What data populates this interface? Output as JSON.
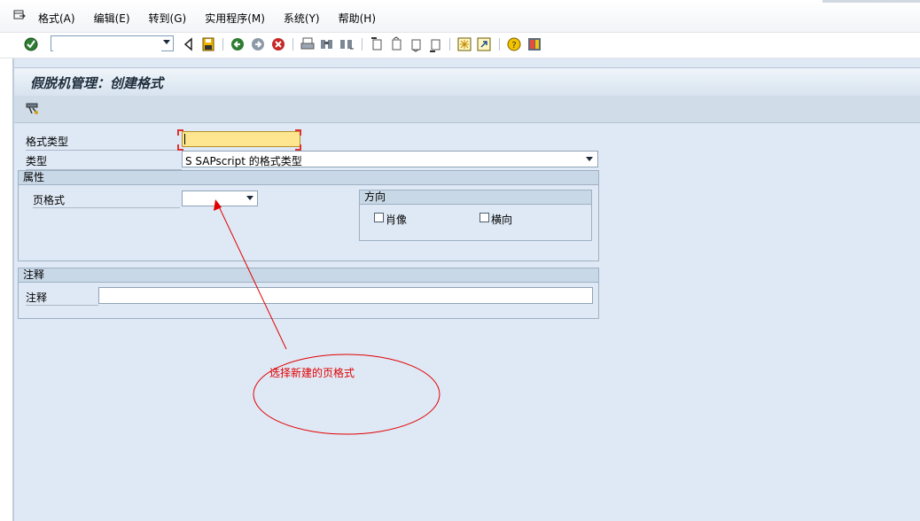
{
  "menu": {
    "items": [
      "格式(A)",
      "编辑(E)",
      "转到(G)",
      "实用程序(M)",
      "系统(Y)",
      "帮助(H)"
    ]
  },
  "toolbar": {
    "command_value": "",
    "icons": [
      "enter-icon",
      "command-field",
      "back-nav-icon",
      "save-icon",
      "back-icon",
      "exit-icon",
      "cancel-icon",
      "print-icon",
      "find-icon",
      "find-next-icon",
      "first-page-icon",
      "previous-page-icon",
      "next-page-icon",
      "last-page-icon",
      "create-session-icon",
      "shortcut-icon",
      "help-icon",
      "layout-icon"
    ]
  },
  "screen": {
    "title": "假脱机管理：创建格式",
    "app_toolbar_icon": "tools-icon"
  },
  "form": {
    "format_type_label": "格式类型",
    "format_type_value": "",
    "type_label": "类型",
    "type_value": "S SAPscript 的格式类型"
  },
  "attributes": {
    "title": "属性",
    "page_format_label": "页格式",
    "page_format_value": "",
    "orientation": {
      "title": "方向",
      "portrait_label": "肖像",
      "portrait_checked": false,
      "landscape_label": "横向",
      "landscape_checked": false
    }
  },
  "comment": {
    "title": "注释",
    "label": "注释",
    "value": ""
  },
  "annotation": {
    "text": "选择新建的页格式",
    "color": "#e00000"
  },
  "colors": {
    "required_field": "#fde68f",
    "panel_bg": "#dfe9f5",
    "group_header": "#c9d8e7"
  }
}
